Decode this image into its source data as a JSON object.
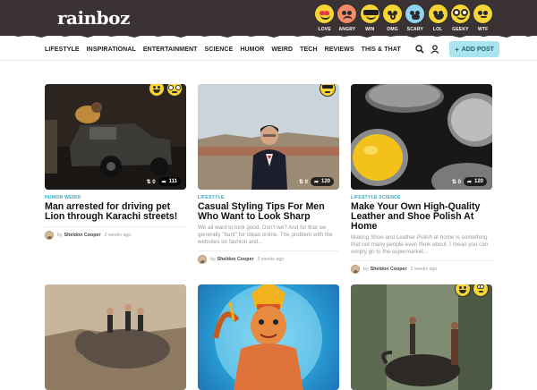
{
  "site": {
    "logo": "rainboz"
  },
  "reactions": [
    {
      "label": "LOVE",
      "icon": "love-face-icon"
    },
    {
      "label": "ANGRY",
      "icon": "angry-face-icon"
    },
    {
      "label": "WIN",
      "icon": "win-face-icon"
    },
    {
      "label": "OMG",
      "icon": "omg-face-icon"
    },
    {
      "label": "SCARY",
      "icon": "scary-face-icon"
    },
    {
      "label": "LOL",
      "icon": "lol-face-icon"
    },
    {
      "label": "GEEKY",
      "icon": "geeky-face-icon"
    },
    {
      "label": "WTF",
      "icon": "wtf-face-icon"
    }
  ],
  "nav": {
    "items": [
      "LIFESTYLE",
      "INSPIRATIONAL",
      "ENTERTAINMENT",
      "SCIENCE",
      "HUMOR",
      "WEIRD",
      "TECH",
      "REVIEWS",
      "THIS & THAT"
    ],
    "add_post": "ADD POST",
    "icons": [
      "search-icon",
      "user-icon"
    ]
  },
  "colors": {
    "header": "#3b3234",
    "accent": "#2ea6bd",
    "add_post_bg": "#a9e4ef",
    "emoji": "#f8d536"
  },
  "posts": [
    {
      "categories": "HUMOR   WEIRD",
      "title": "Man arrested for driving pet Lion through Karachi streets!",
      "excerpt": "",
      "author": "Sheldon Cooper",
      "by": "by",
      "time": "2 weeks ago",
      "reposts": "0",
      "shares": "111",
      "badges": [
        "lol",
        "geeky"
      ]
    },
    {
      "categories": "LIFESTYLE",
      "title": "Casual Styling Tips For Men Who Want to Look Sharp",
      "excerpt": "We all want to look good. Don't we? And for that we generally \"hunt\" for ideas online. The problem with the websites on fashion and...",
      "author": "Sheldon Cooper",
      "by": "by",
      "time": "3 weeks ago",
      "reposts": "0",
      "shares": "120",
      "badges": [
        "win"
      ]
    },
    {
      "categories": "LIFESTYLE   SCIENCE",
      "title": "Make Your Own High-Quality Leather and Shoe Polish At Home",
      "excerpt": "Making Shoe and Leather Polish at home is something that not many people even think about. I mean you can simply go to the supermarket...",
      "author": "Sheldon Cooper",
      "by": "by",
      "time": "3 weeks ago",
      "reposts": "0",
      "shares": "120",
      "badges": []
    },
    {
      "badges": []
    },
    {
      "badges": []
    },
    {
      "badges": [
        "lol",
        "wtf"
      ]
    }
  ]
}
